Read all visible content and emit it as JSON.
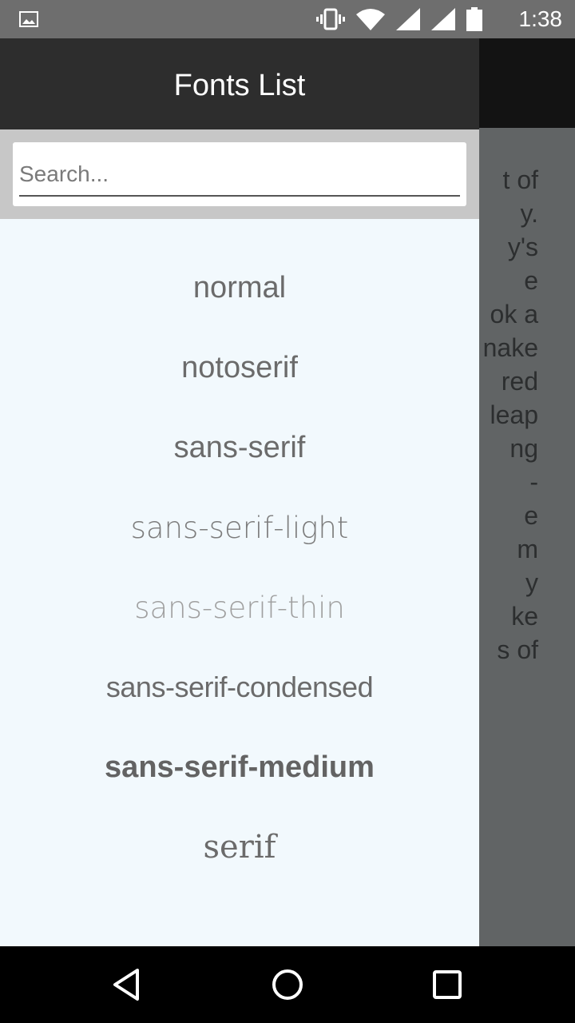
{
  "status_bar": {
    "time": "1:38",
    "icons": [
      "gallery-icon",
      "vibrate-icon",
      "wifi-icon",
      "signal-icon",
      "signal-icon",
      "battery-icon"
    ]
  },
  "drawer": {
    "title": "Fonts List",
    "search": {
      "placeholder": "Search...",
      "value": ""
    },
    "fonts": [
      {
        "label": "normal"
      },
      {
        "label": "notoserif"
      },
      {
        "label": "sans-serif"
      },
      {
        "label": "sans-serif-light"
      },
      {
        "label": "sans-serif-thin"
      },
      {
        "label": "sans-serif-condensed"
      },
      {
        "label": "sans-serif-medium"
      },
      {
        "label": "serif"
      }
    ]
  },
  "background_text": "t of\ny.\ny's\ne\nok a\nnake\nred\n leap\nng\n-\ne\nm\ny\nke\ns of",
  "nav_bar": {
    "buttons": [
      "back-icon",
      "home-icon",
      "recent-apps-icon"
    ]
  },
  "colors": {
    "drawer_header": "#2d2d2d",
    "drawer_background": "#f2f9fd",
    "search_panel": "#c7c7c7",
    "status_bar": "#6e6e6e",
    "nav_bar": "#000000"
  }
}
